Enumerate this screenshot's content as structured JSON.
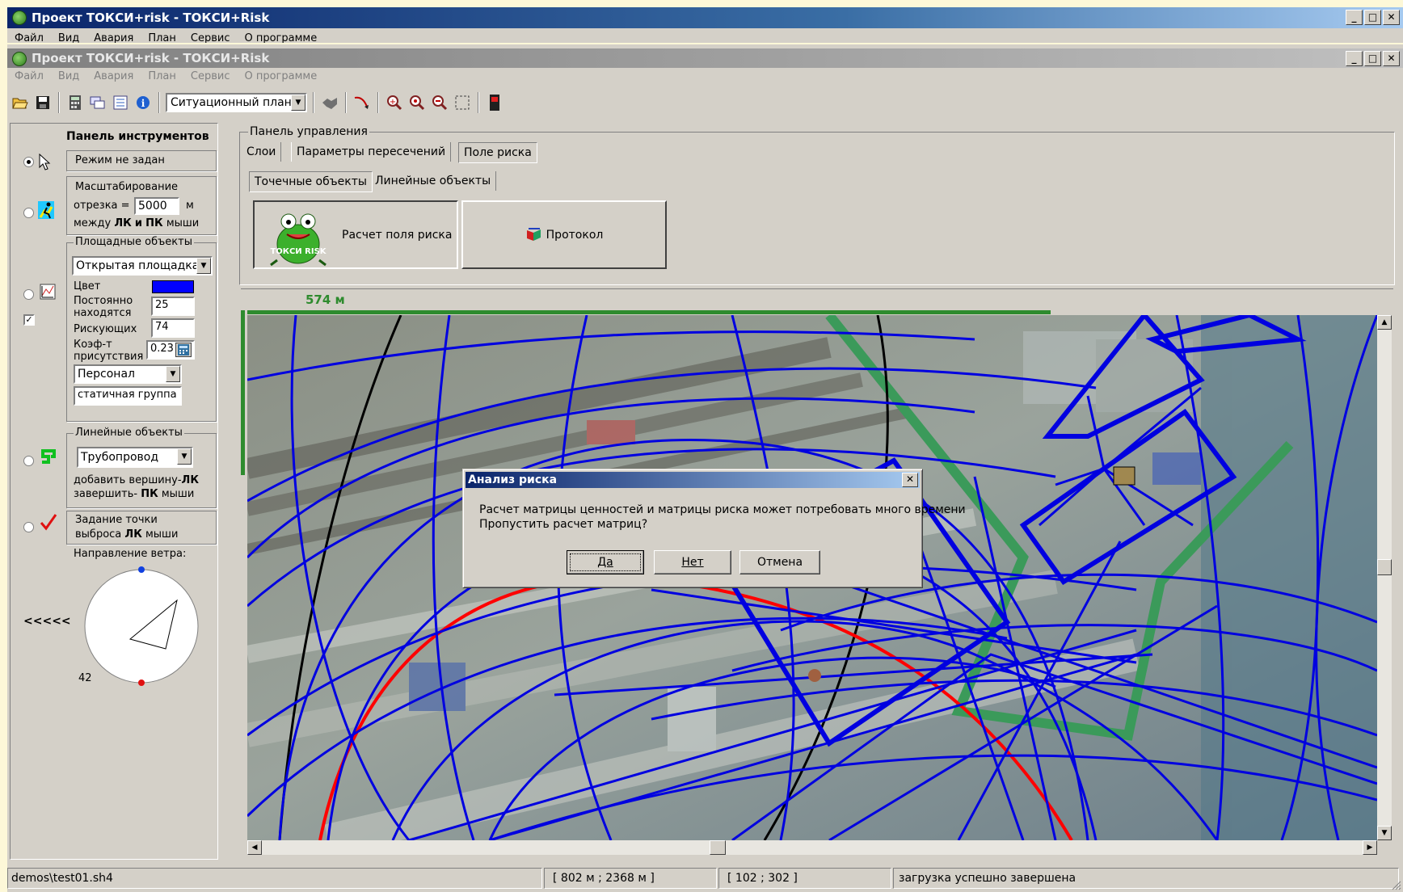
{
  "outer_window": {
    "title": "Проект ТОКСИ+risk - ТОКСИ+Risk",
    "menu": [
      "Файл",
      "Вид",
      "Авария",
      "План",
      "Сервис",
      "О программе"
    ]
  },
  "inner_window": {
    "title": "Проект ТОКСИ+risk - ТОКСИ+Risk",
    "menu": [
      "Файл",
      "Вид",
      "Авария",
      "План",
      "Сервис",
      "О программе"
    ]
  },
  "toolbar": {
    "view_select": "Ситуационный план"
  },
  "tools_panel": {
    "title": "Панель инструментов",
    "mode_label": "Режим не задан",
    "scale": {
      "title": "Масштабирование",
      "segment_label": "отрезка =",
      "segment_value": "5000",
      "unit": "м",
      "between_a": "между",
      "lk": "ЛК",
      "and": "и",
      "pk": "ПК",
      "mouse": "мыши"
    },
    "area_objects": {
      "title": "Площадные объекты",
      "type_select": "Открытая площадка",
      "color_label": "Цвет",
      "color_value": "#0000ff",
      "constantly_label_1": "Постоянно",
      "constantly_label_2": "находятся",
      "constantly_value": "25",
      "at_risk_label": "Рискующих",
      "at_risk_value": "74",
      "coef_label_1": "Коэф-т",
      "coef_label_2": "присутствия",
      "coef_value": "0.23",
      "people_select": "Персонал",
      "group_value": "статичная группа"
    },
    "linear_objects": {
      "title": "Линейные объекты",
      "type_select": "Трубопровод",
      "add_vertex": "добавить вершину-",
      "finish": "завершить-",
      "lk": "ЛК",
      "pk": "ПК",
      "mouse": "мыши"
    },
    "release_point": {
      "line1": "Задание точки",
      "line2": "выброса",
      "lk": "ЛК",
      "mouse": "мыши"
    },
    "wind": {
      "label": "Направление ветра:",
      "arrows": "<<<<<",
      "value": "42"
    }
  },
  "control_panel": {
    "title": "Панель управления",
    "tabs": [
      "Слои",
      "Параметры пересечений",
      "Поле риска"
    ],
    "subtabs": [
      "Точечные объекты",
      "Линейные объекты"
    ],
    "calc_button": "Расчет поля риска",
    "protocol_button": "Протокол",
    "logo_text": "ТОКСИ RISK"
  },
  "map": {
    "scale_label": "574 м"
  },
  "dialog": {
    "title": "Анализ риска",
    "line1": "Расчет матрицы ценностей и матрицы риска может потребовать много времени",
    "line2": "Пропустить расчет матриц?",
    "yes": "Да",
    "no": "Нет",
    "cancel": "Отмена"
  },
  "status_bar": {
    "file": "demos\\test01.sh4",
    "coords_m": "[ 802 м ; 2368 м ]",
    "coords_px": "[ 102 ; 302 ]",
    "message": "загрузка успешно завершена"
  },
  "colors": {
    "risk_contour": "#0000e0",
    "red_contour": "#ff0000",
    "zone_green": "#3b9a5a",
    "scale_green": "#2e8b2e"
  }
}
